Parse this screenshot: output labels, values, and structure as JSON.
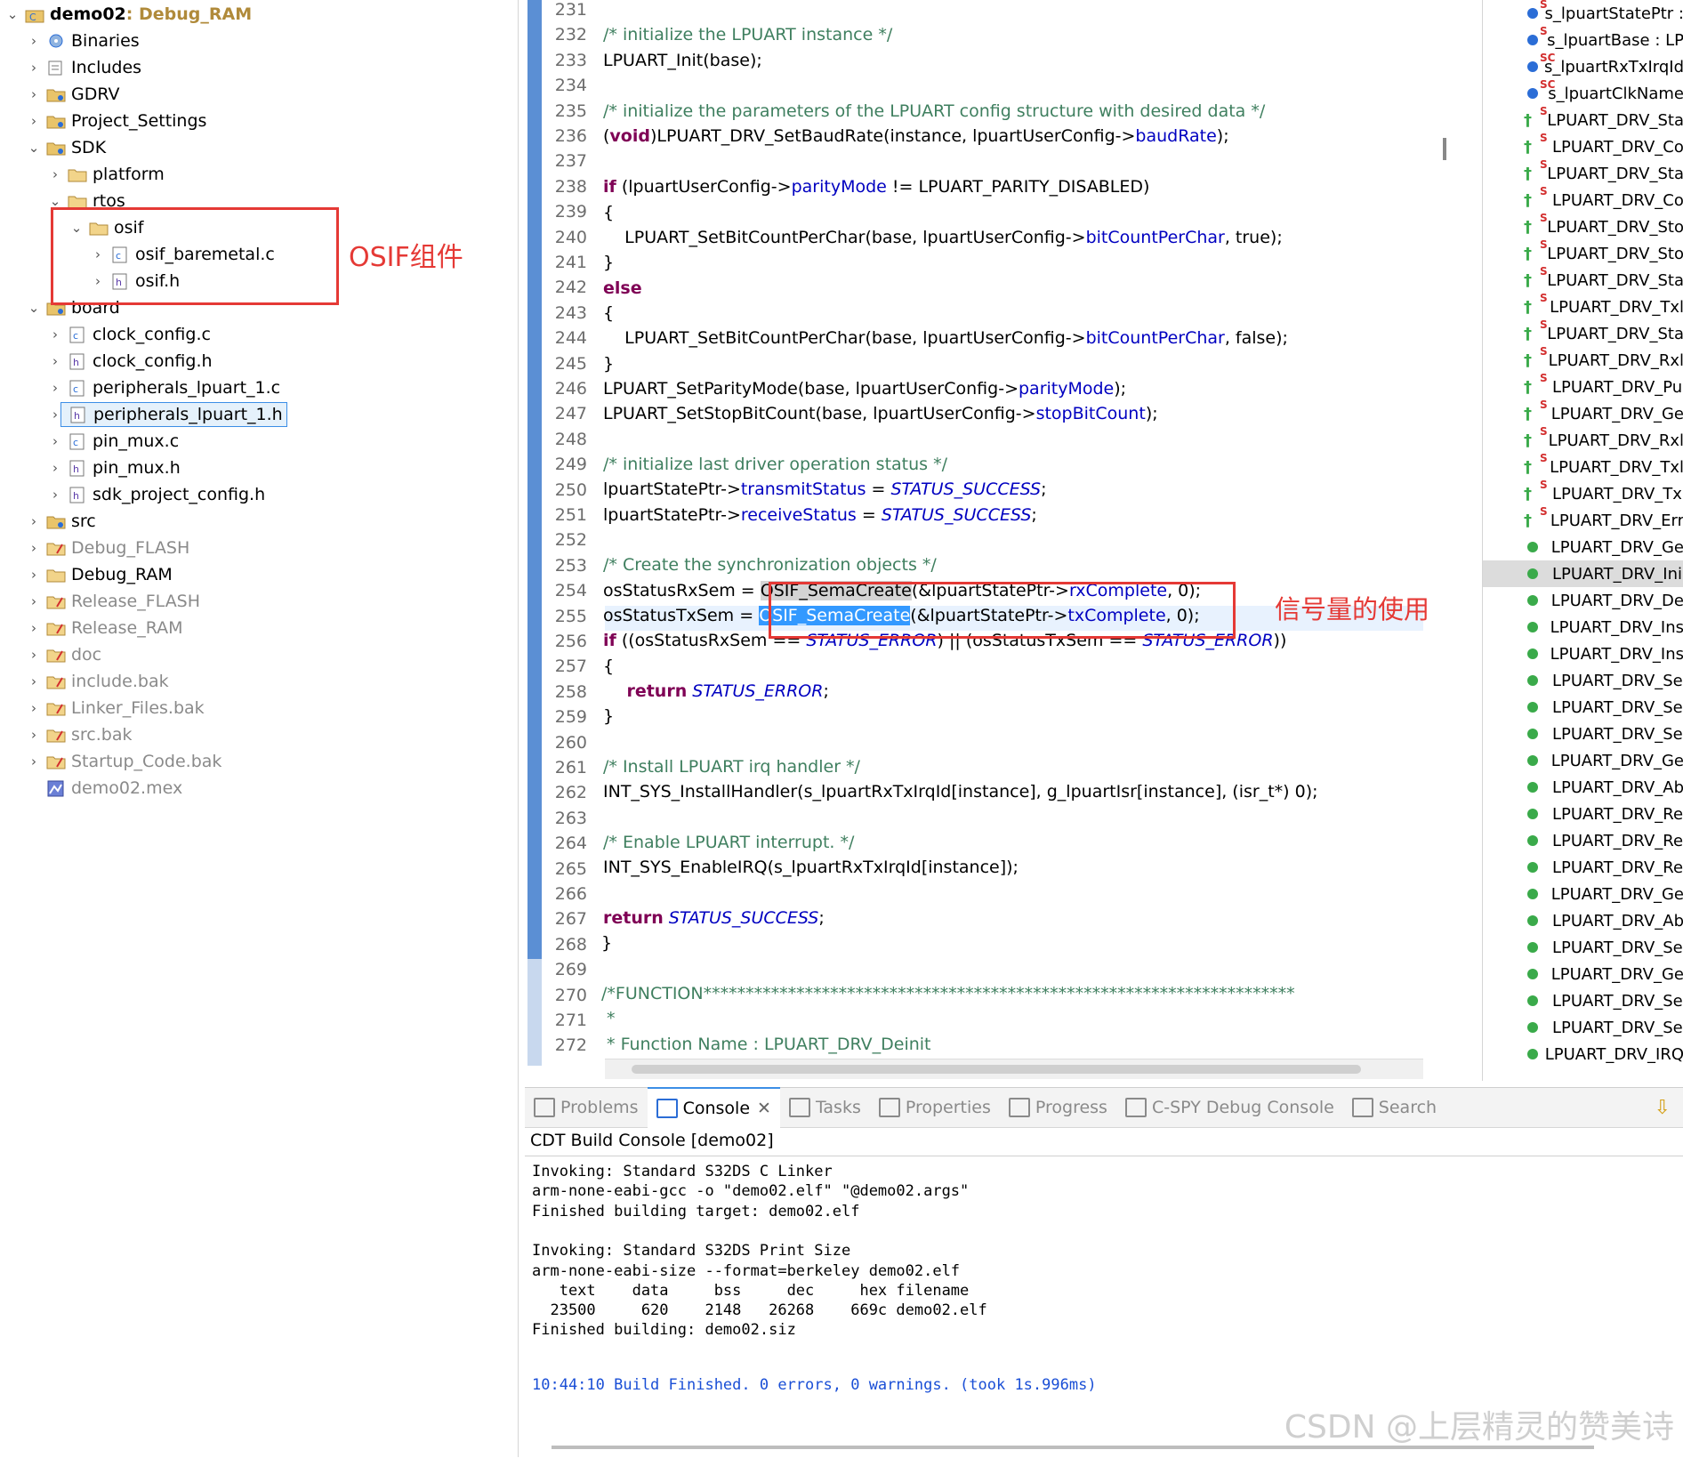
{
  "explorer": {
    "project_name": "demo02",
    "project_cfg": ": Debug_RAM",
    "items": [
      {
        "label": "Binaries"
      },
      {
        "label": "Includes"
      },
      {
        "label": "GDRV"
      },
      {
        "label": "Project_Settings"
      },
      {
        "label": "SDK"
      },
      {
        "label": "platform"
      },
      {
        "label": "rtos"
      },
      {
        "label": "osif"
      },
      {
        "label": "osif_baremetal.c"
      },
      {
        "label": "osif.h"
      },
      {
        "label": "board"
      },
      {
        "label": "clock_config.c"
      },
      {
        "label": "clock_config.h"
      },
      {
        "label": "peripherals_lpuart_1.c"
      },
      {
        "label": "peripherals_lpuart_1.h"
      },
      {
        "label": "pin_mux.c"
      },
      {
        "label": "pin_mux.h"
      },
      {
        "label": "sdk_project_config.h"
      },
      {
        "label": "src"
      },
      {
        "label": "Debug_FLASH"
      },
      {
        "label": "Debug_RAM"
      },
      {
        "label": "Release_FLASH"
      },
      {
        "label": "Release_RAM"
      },
      {
        "label": "doc"
      },
      {
        "label": "include.bak"
      },
      {
        "label": "Linker_Files.bak"
      },
      {
        "label": "src.bak"
      },
      {
        "label": "Startup_Code.bak"
      },
      {
        "label": "demo02.mex"
      }
    ],
    "annotation": "OSIF组件"
  },
  "editor": {
    "line_numbers": [
      "231",
      "232",
      "233",
      "234",
      "235",
      "236",
      "237",
      "238",
      "239",
      "240",
      "241",
      "242",
      "243",
      "244",
      "245",
      "246",
      "247",
      "248",
      "249",
      "250",
      "251",
      "252",
      "253",
      "254",
      "255",
      "256",
      "257",
      "258",
      "259",
      "260",
      "261",
      "262",
      "263",
      "264",
      "265",
      "266",
      "267",
      "268",
      "269",
      "270",
      "271",
      "272"
    ],
    "lines": {
      "l232": "/* initialize the LPUART instance */",
      "l233": "LPUART_Init(base);",
      "l235": "/* initialize the parameters of the LPUART config structure with desired data */",
      "l236a": "(",
      "l236kw": "void",
      "l236b": ")LPUART_DRV_SetBaudRate(instance, lpuartUserConfig->",
      "l236f": "baudRate",
      "l236c": ");",
      "l238kw": "if",
      "l238a": " (lpuartUserConfig->",
      "l238f": "parityMode",
      "l238b": " != LPUART_PARITY_DISABLED)",
      "l239": "{",
      "l240a": "    LPUART_SetBitCountPerChar(base, lpuartUserConfig->",
      "l240f": "bitCountPerChar",
      "l240b": ", true);",
      "l241": "}",
      "l242kw": "else",
      "l243": "{",
      "l244a": "    LPUART_SetBitCountPerChar(base, lpuartUserConfig->",
      "l244f": "bitCountPerChar",
      "l244b": ", false);",
      "l245": "}",
      "l246a": "LPUART_SetParityMode(base, lpuartUserConfig->",
      "l246f": "parityMode",
      "l246b": ");",
      "l247a": "LPUART_SetStopBitCount(base, lpuartUserConfig->",
      "l247f": "stopBitCount",
      "l247b": ");",
      "l249": "/* initialize last driver operation status */",
      "l250a": "lpuartStatePtr->",
      "l250f": "transmitStatus",
      "l250b": " = ",
      "l250e": "STATUS_SUCCESS",
      "l250c": ";",
      "l251a": "lpuartStatePtr->",
      "l251f": "receiveStatus",
      "l251b": " = ",
      "l251e": "STATUS_SUCCESS",
      "l251c": ";",
      "l253": "/* Create the synchronization objects */",
      "l254a": "osStatusRxSem = ",
      "l254h": "OSIF_SemaCreate",
      "l254b": "(&lpuartStatePtr->",
      "l254f": "rxComplete",
      "l254c": ", 0);",
      "l255a": "osStatusTxSem = ",
      "l255h": "OSIF_SemaCreate",
      "l255b": "(&lpuartStatePtr->",
      "l255f": "txComplete",
      "l255c": ", 0);",
      "l256kw": "if",
      "l256a": " ((osStatusRxSem == ",
      "l256e1": "STATUS_ERROR",
      "l256b": ") || (osStatusTxSem == ",
      "l256e2": "STATUS_ERROR",
      "l256c": "))",
      "l257": "{",
      "l258kw": "    return",
      "l258e": " STATUS_ERROR",
      "l258c": ";",
      "l259": "}",
      "l261": "/* Install LPUART irq handler */",
      "l262": "INT_SYS_InstallHandler(s_lpuartRxTxIrqId[instance], g_lpuartIsr[instance], (isr_t*) 0);",
      "l264": "/* Enable LPUART interrupt. */",
      "l265": "INT_SYS_EnableIRQ(s_lpuartRxTxIrqId[instance]);",
      "l267kw": "return",
      "l267e": " STATUS_SUCCESS",
      "l267c": ";",
      "l268": "}",
      "l270": "/*FUNCTION**********************************************************************",
      "l271": " *",
      "l272": " * Function Name : LPUART_DRV_Deinit"
    },
    "annotation": "信号量的使用"
  },
  "outline": {
    "items": [
      {
        "label": "s_lpuartStatePtr :",
        "kind": "var",
        "sup": "S"
      },
      {
        "label": "s_lpuartBase : LP",
        "kind": "var",
        "sup": "S"
      },
      {
        "label": "s_lpuartRxTxIrqId",
        "kind": "var",
        "sup": "SC"
      },
      {
        "label": "s_lpuartClkName",
        "kind": "var",
        "sup": "SC"
      },
      {
        "label": "LPUART_DRV_Sta",
        "kind": "decl",
        "sup": "S"
      },
      {
        "label": "LPUART_DRV_Co",
        "kind": "decl",
        "sup": "S"
      },
      {
        "label": "LPUART_DRV_Sta",
        "kind": "decl",
        "sup": "S"
      },
      {
        "label": "LPUART_DRV_Co",
        "kind": "decl",
        "sup": "S"
      },
      {
        "label": "LPUART_DRV_Sto",
        "kind": "decl",
        "sup": "S"
      },
      {
        "label": "LPUART_DRV_Sto",
        "kind": "decl",
        "sup": "S"
      },
      {
        "label": "LPUART_DRV_Sta",
        "kind": "decl",
        "sup": "S"
      },
      {
        "label": "LPUART_DRV_Txl",
        "kind": "decl",
        "sup": "S"
      },
      {
        "label": "LPUART_DRV_Sta",
        "kind": "decl",
        "sup": "S"
      },
      {
        "label": "LPUART_DRV_Rxl",
        "kind": "decl",
        "sup": "S"
      },
      {
        "label": "LPUART_DRV_Pu",
        "kind": "decl",
        "sup": "S"
      },
      {
        "label": "LPUART_DRV_Ge",
        "kind": "decl",
        "sup": "S"
      },
      {
        "label": "LPUART_DRV_Rxl",
        "kind": "decl",
        "sup": "S"
      },
      {
        "label": "LPUART_DRV_Txl",
        "kind": "decl",
        "sup": "S"
      },
      {
        "label": "LPUART_DRV_Tx",
        "kind": "decl",
        "sup": "S"
      },
      {
        "label": "LPUART_DRV_Err",
        "kind": "decl",
        "sup": "S"
      },
      {
        "label": "LPUART_DRV_Ge",
        "kind": "fn",
        "sup": ""
      },
      {
        "label": "LPUART_DRV_Ini",
        "kind": "fn",
        "sup": "",
        "selected": true
      },
      {
        "label": "LPUART_DRV_De",
        "kind": "fn",
        "sup": ""
      },
      {
        "label": "LPUART_DRV_Ins",
        "kind": "fn",
        "sup": ""
      },
      {
        "label": "LPUART_DRV_Ins",
        "kind": "fn",
        "sup": ""
      },
      {
        "label": "LPUART_DRV_Se",
        "kind": "fn",
        "sup": ""
      },
      {
        "label": "LPUART_DRV_Se",
        "kind": "fn",
        "sup": ""
      },
      {
        "label": "LPUART_DRV_Se",
        "kind": "fn",
        "sup": ""
      },
      {
        "label": "LPUART_DRV_Ge",
        "kind": "fn",
        "sup": ""
      },
      {
        "label": "LPUART_DRV_Ab",
        "kind": "fn",
        "sup": ""
      },
      {
        "label": "LPUART_DRV_Re",
        "kind": "fn",
        "sup": ""
      },
      {
        "label": "LPUART_DRV_Re",
        "kind": "fn",
        "sup": ""
      },
      {
        "label": "LPUART_DRV_Re",
        "kind": "fn",
        "sup": ""
      },
      {
        "label": "LPUART_DRV_Ge",
        "kind": "fn",
        "sup": ""
      },
      {
        "label": "LPUART_DRV_Ab",
        "kind": "fn",
        "sup": ""
      },
      {
        "label": "LPUART_DRV_Se",
        "kind": "fn",
        "sup": ""
      },
      {
        "label": "LPUART_DRV_Ge",
        "kind": "fn",
        "sup": ""
      },
      {
        "label": "LPUART_DRV_Se",
        "kind": "fn",
        "sup": ""
      },
      {
        "label": "LPUART_DRV_Se",
        "kind": "fn",
        "sup": ""
      },
      {
        "label": "LPUART_DRV_IRQ",
        "kind": "fn",
        "sup": ""
      }
    ]
  },
  "console": {
    "tabs": [
      "Problems",
      "Console",
      "Tasks",
      "Properties",
      "Progress",
      "C-SPY Debug Console",
      "Search"
    ],
    "title": "CDT Build Console [demo02]",
    "lines": [
      "Invoking: Standard S32DS C Linker",
      "arm-none-eabi-gcc -o \"demo02.elf\" \"@demo02.args\"",
      "Finished building target: demo02.elf",
      "",
      "Invoking: Standard S32DS Print Size",
      "arm-none-eabi-size --format=berkeley demo02.elf",
      "   text    data     bss     dec     hex filename",
      "  23500     620    2148   26268    669c demo02.elf",
      "Finished building: demo02.siz",
      "",
      ""
    ],
    "status": "10:44:10 Build Finished. 0 errors, 0 warnings. (took 1s.996ms)"
  },
  "watermark": "CSDN @上层精灵的赞美诗"
}
